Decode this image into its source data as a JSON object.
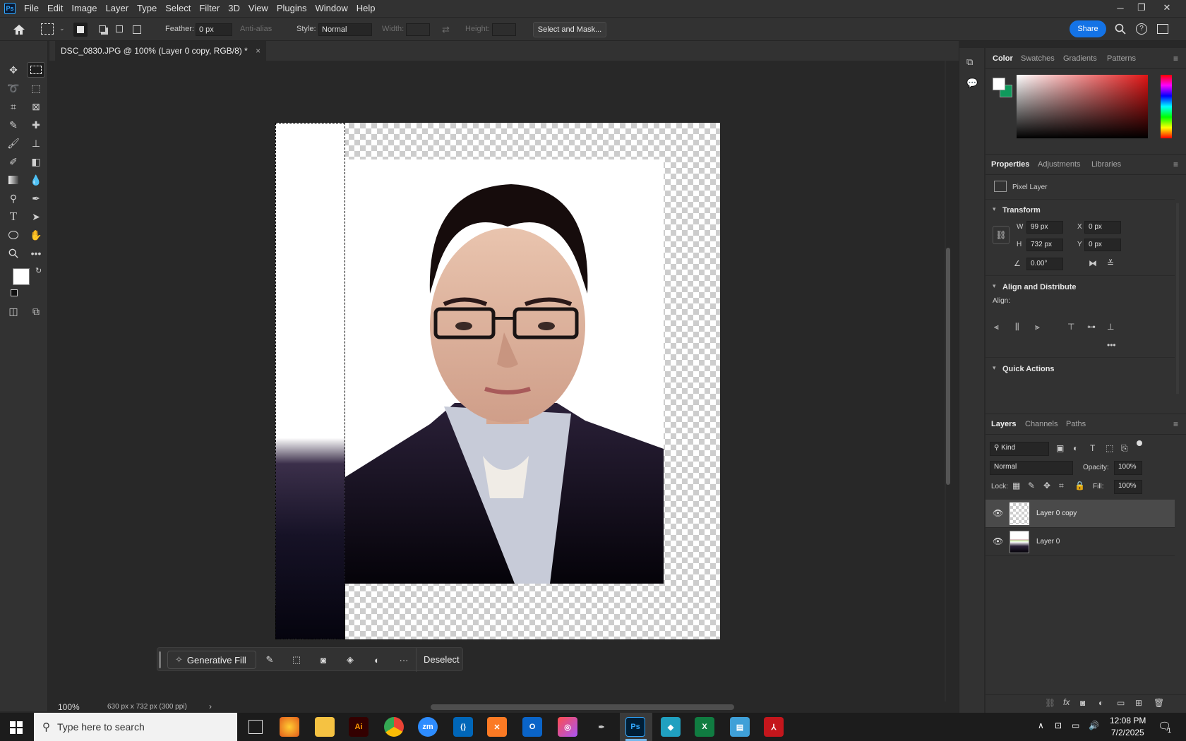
{
  "menu": {
    "items": [
      "File",
      "Edit",
      "Image",
      "Layer",
      "Type",
      "Select",
      "Filter",
      "3D",
      "View",
      "Plugins",
      "Window",
      "Help"
    ]
  },
  "options_bar": {
    "feather_label": "Feather:",
    "feather_value": "0 px",
    "antialias_label": "Anti-alias",
    "style_label": "Style:",
    "style_value": "Normal",
    "width_label": "Width:",
    "height_label": "Height:",
    "select_mask_label": "Select and Mask...",
    "share_label": "Share"
  },
  "document": {
    "tab_title": "DSC_0830.JPG @ 100% (Layer 0 copy, RGB/8) *",
    "close": "×"
  },
  "status": {
    "zoom": "100%",
    "info": "630 px x 732 px (300 ppi)"
  },
  "context_bar": {
    "generative_fill": "Generative Fill",
    "deselect": "Deselect",
    "more": "···"
  },
  "color_panel": {
    "tabs": [
      "Color",
      "Swatches",
      "Gradients",
      "Patterns"
    ],
    "foreground": "#ffffff",
    "background": "#0f9a5c"
  },
  "properties_panel": {
    "tabs": [
      "Properties",
      "Adjustments",
      "Libraries"
    ],
    "kind": "Pixel Layer",
    "transform_title": "Transform",
    "w_label": "W",
    "w_value": "99 px",
    "h_label": "H",
    "h_value": "732 px",
    "x_label": "X",
    "x_value": "0 px",
    "y_label": "Y",
    "y_value": "0 px",
    "angle_value": "0.00°",
    "align_title": "Align and Distribute",
    "align_label": "Align:",
    "quick_actions_title": "Quick Actions"
  },
  "layers_panel": {
    "tabs": [
      "Layers",
      "Channels",
      "Paths"
    ],
    "filter_kind": "Kind",
    "blend_mode": "Normal",
    "opacity_label": "Opacity:",
    "opacity_value": "100%",
    "lock_label": "Lock:",
    "fill_label": "Fill:",
    "fill_value": "100%",
    "layers": [
      {
        "name": "Layer 0 copy",
        "selected": true
      },
      {
        "name": "Layer 0",
        "selected": false
      }
    ]
  },
  "taskbar": {
    "search_placeholder": "Type here to search",
    "time": "12:08 PM",
    "date": "7/2/2025",
    "notification_count": "1"
  },
  "colors": {
    "accent": "#1473e6",
    "selection_green": "#0f9a5c"
  }
}
